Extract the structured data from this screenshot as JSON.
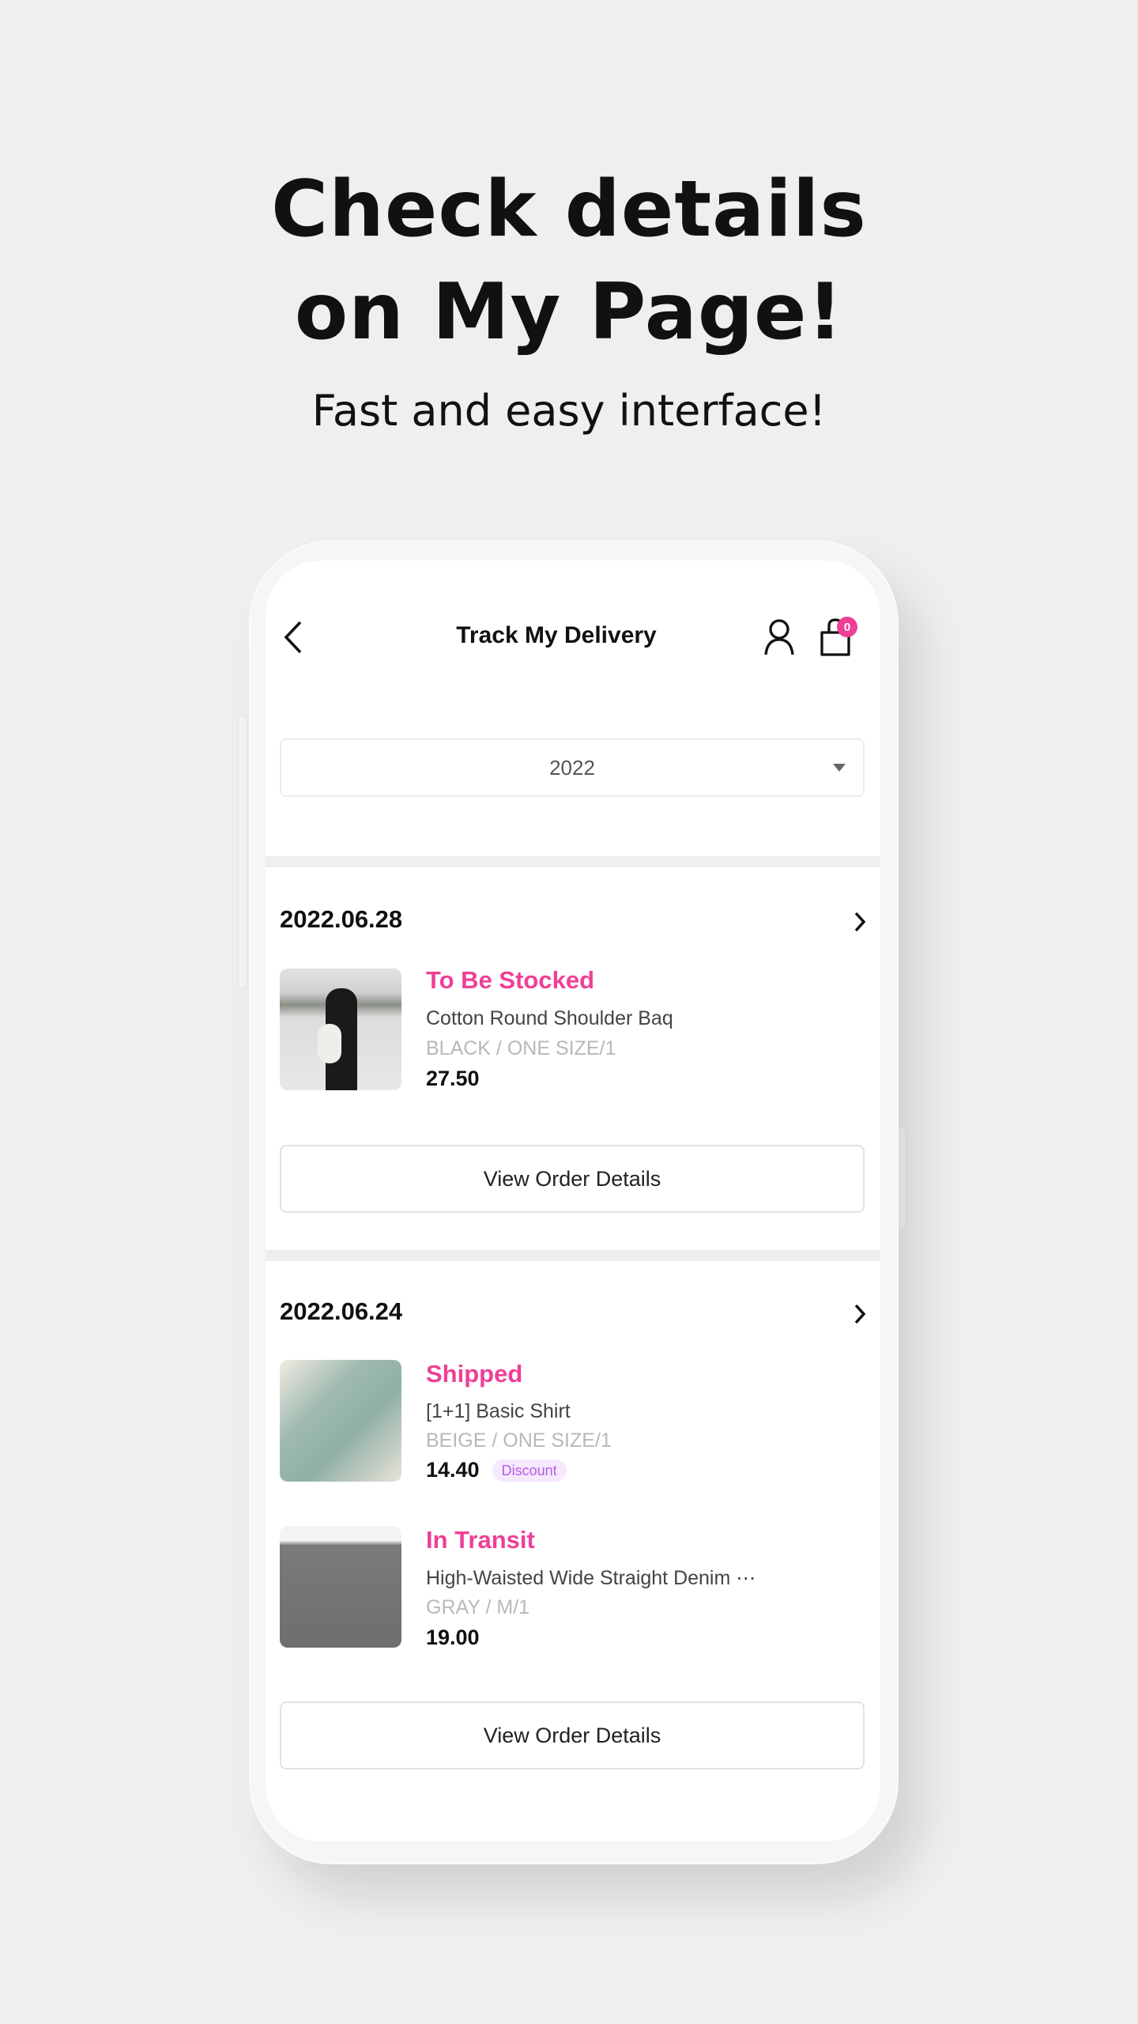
{
  "promo": {
    "headline_line1": "Check details",
    "headline_line2": "on My Page!",
    "subtitle": "Fast and easy interface!"
  },
  "header": {
    "title": "Track My Delivery",
    "cart_count": "0"
  },
  "year_select": {
    "value": "2022"
  },
  "colors": {
    "accent": "#ef3f96",
    "badge": "#b85ce0"
  },
  "orders": [
    {
      "date": "2022.06.28",
      "button": "View Order Details",
      "items": [
        {
          "status": "To Be Stocked",
          "name": "Cotton Round Shoulder Baq",
          "variant": "BLACK / ONE SIZE/1",
          "price": "27.50"
        }
      ]
    },
    {
      "date": "2022.06.24",
      "button": "View Order Details",
      "items": [
        {
          "status": "Shipped",
          "name": "[1+1] Basic Shirt",
          "variant": "BEIGE / ONE SIZE/1",
          "price": "14.40",
          "badge": "Discount"
        },
        {
          "status": "In Transit",
          "name": "High-Waisted Wide Straight Denim ⋯",
          "variant": "GRAY / M/1",
          "price": "19.00"
        }
      ]
    }
  ]
}
